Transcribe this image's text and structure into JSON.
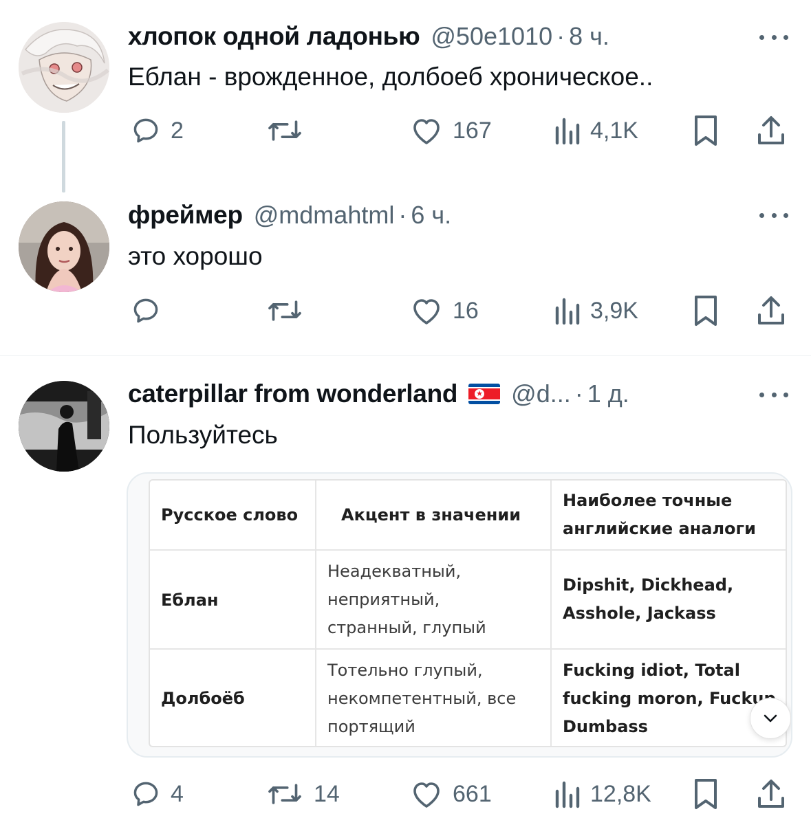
{
  "tweets": [
    {
      "name": "хлопок одной ладонью",
      "handle": "@50e1010",
      "separator": "·",
      "time": "8 ч.",
      "text": "Еблан - врожденное, долбоеб хроническое..",
      "replies": "2",
      "retweets": "",
      "likes": "167",
      "views": "4,1K"
    },
    {
      "name": "фреймер",
      "handle": "@mdmahtml",
      "separator": "·",
      "time": "6 ч.",
      "text": "это хорошо",
      "replies": "",
      "retweets": "",
      "likes": "16",
      "views": "3,9K"
    },
    {
      "name": "caterpillar from wonderland",
      "flag": "north-korea-flag",
      "handle": "@d...",
      "separator": "·",
      "time": "1 д.",
      "text": "Пользуйтесь",
      "replies": "4",
      "retweets": "14",
      "likes": "661",
      "views": "12,8K"
    }
  ],
  "table": {
    "headers": [
      "Русское слово",
      "Акцент в значении",
      "Наиболее точные английские аналоги"
    ],
    "header3_lines": [
      "Наиболее точные",
      "английские аналоги"
    ],
    "rows": [
      {
        "word": "Еблан",
        "accent_lines": [
          "Неадекватный,",
          "неприятный,",
          "странный, глупый"
        ],
        "english_lines": [
          "Dipshit, Dickhead,",
          "Asshole, Jackass"
        ]
      },
      {
        "word": "Долбоёб",
        "accent_lines": [
          "Тотельно глупый,",
          "некомпетентный, все",
          "портящий"
        ],
        "english_lines": [
          "Fucking idiot, Total",
          "fucking moron, Fuckup",
          "Dumbass"
        ]
      }
    ]
  },
  "colors": {
    "text": "#0f1419",
    "muted": "#536471",
    "thread_line": "#cfd9de",
    "divider": "#eff3f4"
  },
  "icons": [
    "reply-icon",
    "retweet-icon",
    "like-icon",
    "views-icon",
    "bookmark-icon",
    "share-icon",
    "more-icon",
    "chevron-down-icon"
  ]
}
